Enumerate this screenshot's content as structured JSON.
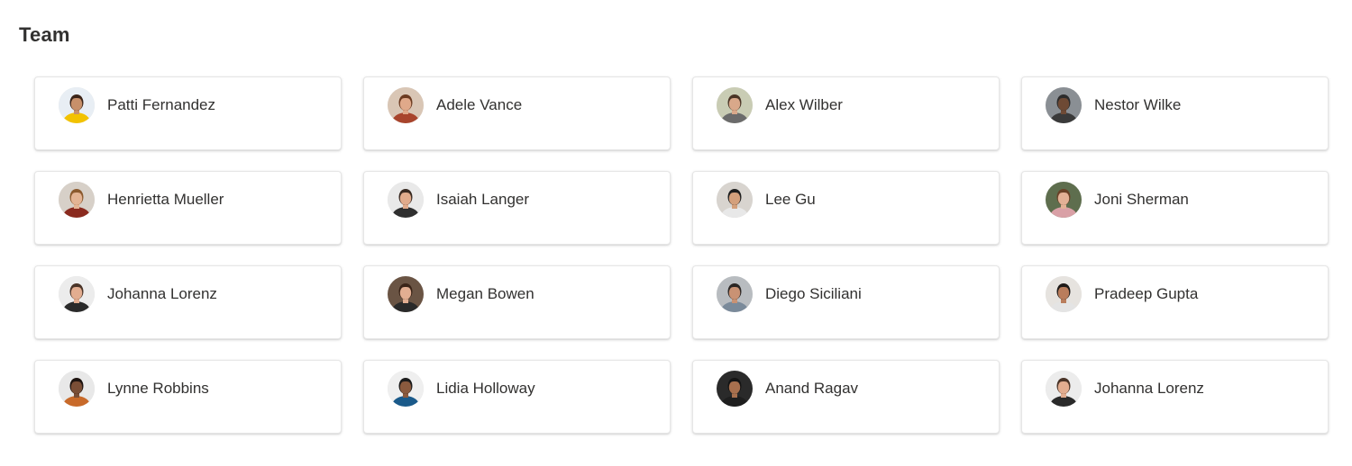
{
  "section": {
    "title": "Team"
  },
  "people": [
    {
      "name": "Patti Fernandez",
      "avatar": {
        "bg": "#e8eef4",
        "skin": "#c8906a",
        "hair": "#3b2418",
        "shirt": "#f2c200"
      }
    },
    {
      "name": "Adele Vance",
      "avatar": {
        "bg": "#d9c6b5",
        "skin": "#e0a98a",
        "hair": "#6b3a20",
        "shirt": "#a8442c"
      }
    },
    {
      "name": "Alex Wilber",
      "avatar": {
        "bg": "#c9ccb4",
        "skin": "#d9a88a",
        "hair": "#4a3426",
        "shirt": "#6b6b6b"
      }
    },
    {
      "name": "Nestor Wilke",
      "avatar": {
        "bg": "#8a8f94",
        "skin": "#6e4a35",
        "hair": "#2c2c2c",
        "shirt": "#3a3a3a"
      }
    },
    {
      "name": "Henrietta Mueller",
      "avatar": {
        "bg": "#d7d0c8",
        "skin": "#e4b494",
        "hair": "#8c5a2e",
        "shirt": "#8a2a1e"
      }
    },
    {
      "name": "Isaiah Langer",
      "avatar": {
        "bg": "#e9e9e9",
        "skin": "#e1ab8c",
        "hair": "#3a2a22",
        "shirt": "#2f2f2f"
      }
    },
    {
      "name": "Lee Gu",
      "avatar": {
        "bg": "#d8d4cf",
        "skin": "#d4a07c",
        "hair": "#1e1e1e",
        "shirt": "#e8e8e8"
      }
    },
    {
      "name": "Joni Sherman",
      "avatar": {
        "bg": "#5e6e4e",
        "skin": "#e3b196",
        "hair": "#6a4228",
        "shirt": "#d9a0a6"
      }
    },
    {
      "name": "Johanna Lorenz",
      "avatar": {
        "bg": "#ececec",
        "skin": "#e2ad90",
        "hair": "#4a3428",
        "shirt": "#2a2a2a"
      }
    },
    {
      "name": "Megan Bowen",
      "avatar": {
        "bg": "#6a5444",
        "skin": "#e2ae92",
        "hair": "#3a2418",
        "shirt": "#2a2a2a"
      }
    },
    {
      "name": "Diego Siciliani",
      "avatar": {
        "bg": "#b8bcc0",
        "skin": "#c99274",
        "hair": "#2a2624",
        "shirt": "#7a8a9a"
      }
    },
    {
      "name": "Pradeep Gupta",
      "avatar": {
        "bg": "#e6e3df",
        "skin": "#b97d5c",
        "hair": "#1e1a18",
        "shirt": "#e4e4e4"
      }
    },
    {
      "name": "Lynne Robbins",
      "avatar": {
        "bg": "#e8e8e8",
        "skin": "#7a4e36",
        "hair": "#1e1410",
        "shirt": "#c86a2a"
      }
    },
    {
      "name": "Lidia Holloway",
      "avatar": {
        "bg": "#efefef",
        "skin": "#8a5a3e",
        "hair": "#1c1c1c",
        "shirt": "#1a5a8a"
      }
    },
    {
      "name": "Anand Ragav",
      "avatar": {
        "bg": "#2a2a2a",
        "skin": "#a8704e",
        "hair": "#141414",
        "shirt": "#1e1e1e"
      }
    },
    {
      "name": "Johanna Lorenz",
      "avatar": {
        "bg": "#ececec",
        "skin": "#e2ad90",
        "hair": "#4a3428",
        "shirt": "#2a2a2a"
      }
    }
  ]
}
